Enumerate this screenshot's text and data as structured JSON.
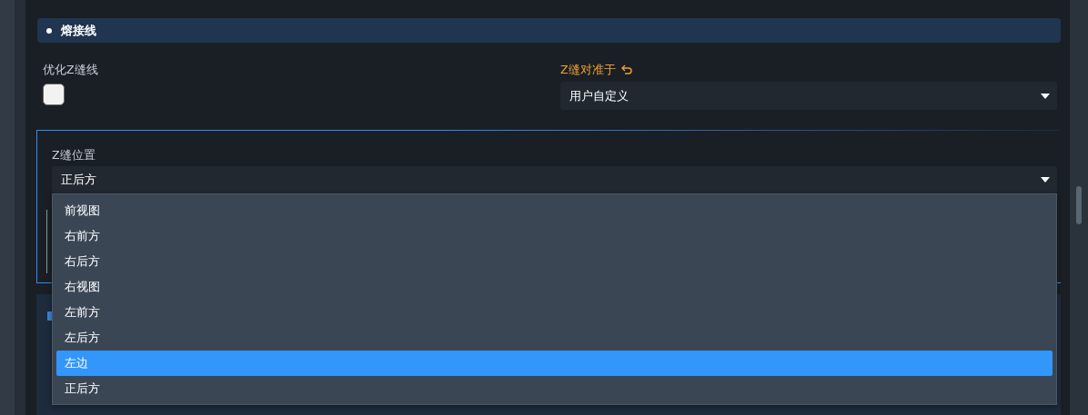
{
  "section": {
    "title": "熔接线"
  },
  "optimize_seam": {
    "label": "优化Z缝线",
    "checked": false
  },
  "seam_alignment": {
    "label": "Z缝对准于",
    "modified": true,
    "value": "用户自定义"
  },
  "seam_position": {
    "label": "Z缝位置",
    "value": "正后方",
    "expanded": true,
    "options": [
      {
        "label": "前视图",
        "highlighted": false
      },
      {
        "label": "右前方",
        "highlighted": false
      },
      {
        "label": "右后方",
        "highlighted": false
      },
      {
        "label": "右视图",
        "highlighted": false
      },
      {
        "label": "左前方",
        "highlighted": false
      },
      {
        "label": "左后方",
        "highlighted": false
      },
      {
        "label": "左边",
        "highlighted": true
      },
      {
        "label": "正后方",
        "highlighted": false
      }
    ]
  }
}
